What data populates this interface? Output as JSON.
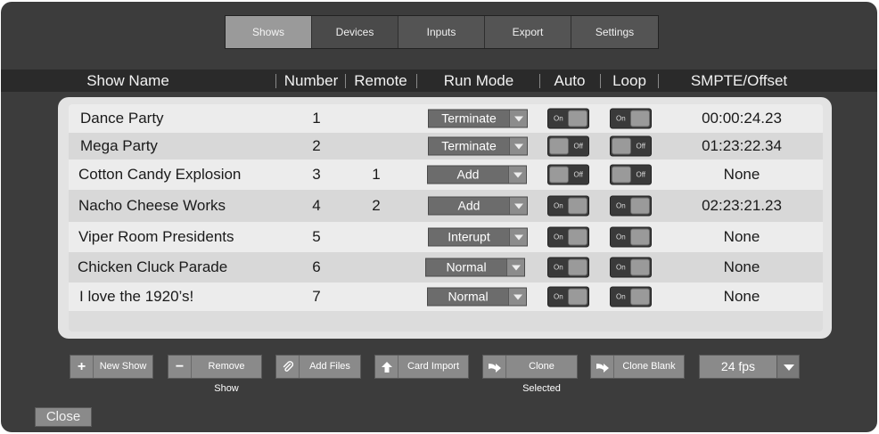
{
  "tabs": [
    {
      "label": "Shows",
      "active": true
    },
    {
      "label": "Devices",
      "active": false
    },
    {
      "label": "Inputs",
      "active": false
    },
    {
      "label": "Export",
      "active": false
    },
    {
      "label": "Settings",
      "active": false
    }
  ],
  "columns": {
    "show_name": "Show Name",
    "number": "Number",
    "remote": "Remote",
    "run_mode": "Run Mode",
    "auto": "Auto",
    "loop": "Loop",
    "smpte": "SMPTE/Offset"
  },
  "toggle_labels": {
    "on": "On",
    "off": "Off"
  },
  "shows": [
    {
      "name": "Dance Party",
      "number": "1",
      "remote": "",
      "run_mode": "Terminate",
      "auto": true,
      "loop": true,
      "smpte": "00:00:24.23"
    },
    {
      "name": "Mega Party",
      "number": "2",
      "remote": "",
      "run_mode": "Terminate",
      "auto": false,
      "loop": false,
      "smpte": "01:23:22.34"
    },
    {
      "name": "Cotton Candy Explosion",
      "number": "3",
      "remote": "1",
      "run_mode": "Add",
      "auto": false,
      "loop": false,
      "smpte": "None"
    },
    {
      "name": "Nacho Cheese Works",
      "number": "4",
      "remote": "2",
      "run_mode": "Add",
      "auto": true,
      "loop": true,
      "smpte": "02:23:21.23"
    },
    {
      "name": "Viper Room Presidents",
      "number": "5",
      "remote": "",
      "run_mode": "Interupt",
      "auto": true,
      "loop": true,
      "smpte": "None"
    },
    {
      "name": "Chicken Cluck Parade",
      "number": "6",
      "remote": "",
      "run_mode": "Normal",
      "auto": true,
      "loop": true,
      "smpte": "None"
    },
    {
      "name": "I love the 1920’s!",
      "number": "7",
      "remote": "",
      "run_mode": "Normal",
      "auto": true,
      "loop": true,
      "smpte": "None"
    }
  ],
  "actions": {
    "new_show": "New Show",
    "remove_show": "Remove Show",
    "add_files": "Add Files",
    "card_import": "Card Import",
    "clone_selected": "Clone Selected",
    "clone_blank": "Clone Blank"
  },
  "fps": "24 fps",
  "close_label": "Close"
}
